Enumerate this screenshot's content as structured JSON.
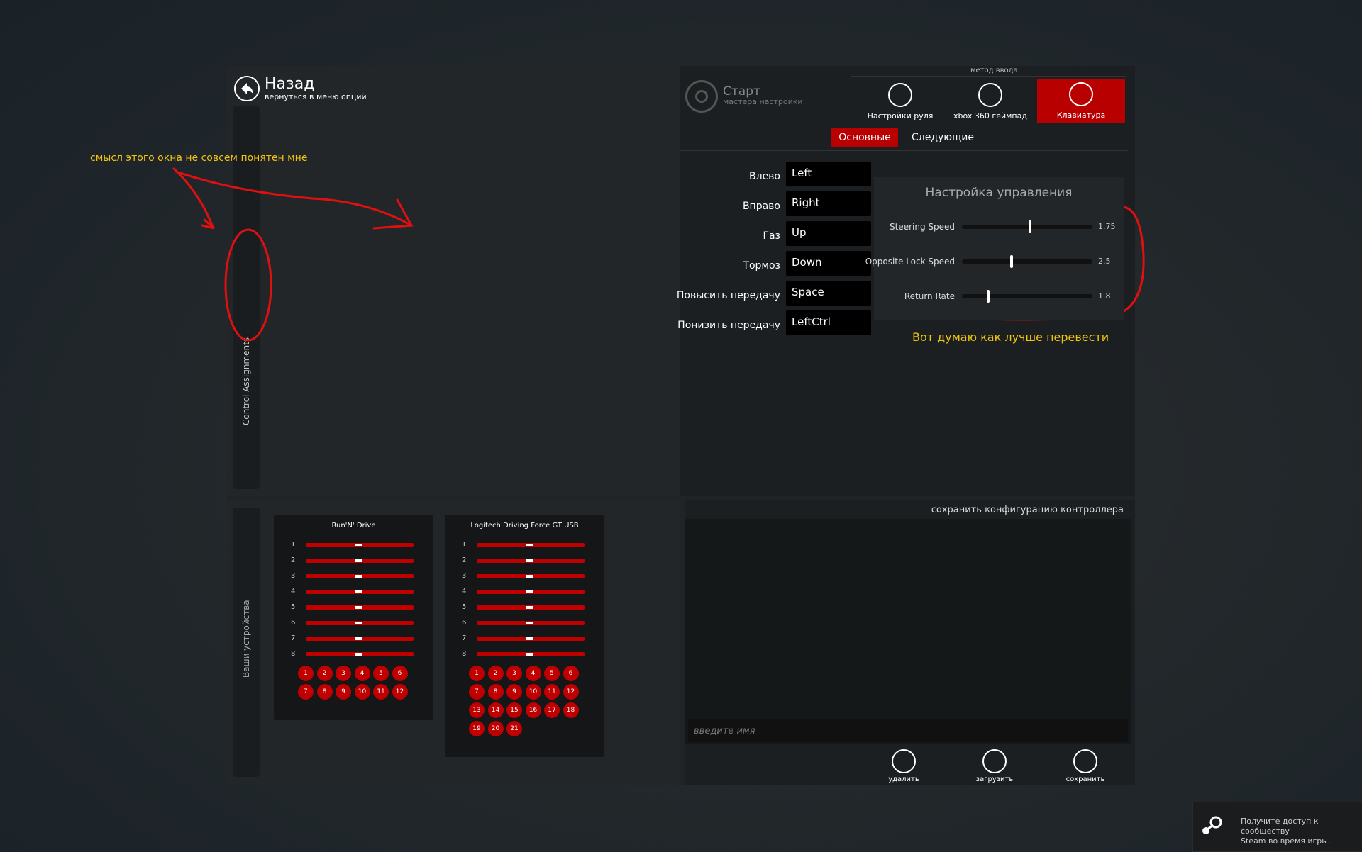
{
  "header": {
    "back_title": "Назад",
    "back_subtitle": "вернуться в меню опций"
  },
  "sidebar": {
    "control_assignments": "Control Assignments",
    "devices": "Ваши устройства"
  },
  "annotations": {
    "note_window": "смысл  этого окна не совсем понятен мне",
    "note_translate": "Вот думаю как лучше перевести"
  },
  "wizard": {
    "title": "Старт",
    "subtitle": "мастера настройки",
    "method_label": "метод ввода",
    "methods": [
      {
        "label": "Настройки руля",
        "icon": "steering-wheel-icon",
        "active": false
      },
      {
        "label": "xbox 360 геймпад",
        "icon": "gamepad-icon",
        "active": false
      },
      {
        "label": "Клавиатура",
        "icon": "keyboard-icon",
        "active": true
      }
    ],
    "tabs": {
      "basic": "Основные",
      "next": "Следующие"
    }
  },
  "bindings": [
    {
      "label": "Влево",
      "key": "Left"
    },
    {
      "label": "Вправо",
      "key": "Right"
    },
    {
      "label": "Газ",
      "key": "Up"
    },
    {
      "label": "Тормоз",
      "key": "Down"
    },
    {
      "label": "Повысить передачу",
      "key": "Space"
    },
    {
      "label": "Понизить передачу",
      "key": "LeftCtrl"
    }
  ],
  "control_settings": {
    "title": "Настройка управления",
    "sliders": [
      {
        "label": "Steering Speed",
        "value": "1.75",
        "fraction": 0.52
      },
      {
        "label": "Opposite Lock Speed",
        "value": "2.5",
        "fraction": 0.38
      },
      {
        "label": "Return Rate",
        "value": "1.8",
        "fraction": 0.2
      }
    ]
  },
  "devices": [
    {
      "name": "Run'N' Drive",
      "axes": [
        "1",
        "2",
        "3",
        "4",
        "5",
        "6",
        "7",
        "8"
      ],
      "buttons": [
        "1",
        "2",
        "3",
        "4",
        "5",
        "6",
        "7",
        "8",
        "9",
        "10",
        "11",
        "12"
      ]
    },
    {
      "name": "Logitech Driving Force GT USB",
      "axes": [
        "1",
        "2",
        "3",
        "4",
        "5",
        "6",
        "7",
        "8"
      ],
      "buttons": [
        "1",
        "2",
        "3",
        "4",
        "5",
        "6",
        "7",
        "8",
        "9",
        "10",
        "11",
        "12",
        "13",
        "14",
        "15",
        "16",
        "17",
        "18",
        "19",
        "20",
        "21"
      ]
    }
  ],
  "config": {
    "title": "сохранить конфигурацию контроллера",
    "name_placeholder": "введите имя",
    "actions": {
      "delete": "удалить",
      "load": "загрузить",
      "save": "сохранить"
    }
  },
  "steam": {
    "line1": "Получите доступ к сообществу",
    "line2": "Steam во время игры."
  },
  "colors": {
    "accent": "#b80000",
    "annotation": "#f1c40f",
    "annotation_stroke": "#e01010"
  }
}
